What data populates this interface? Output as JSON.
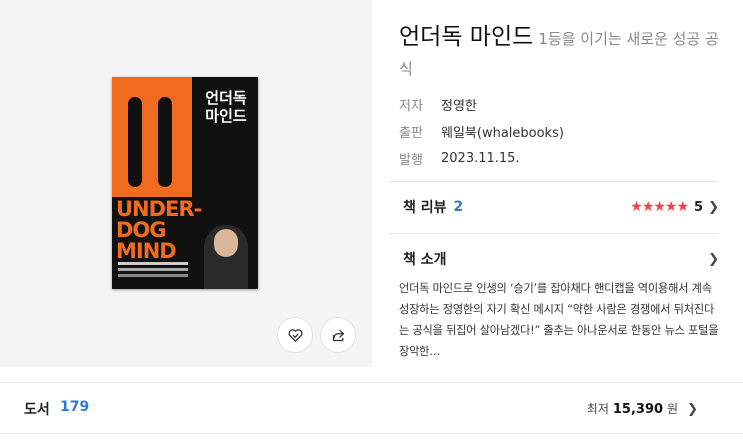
{
  "book": {
    "title": "언더독 마인드",
    "subtitle": "1등을 이기는 새로운 성공 공식",
    "cover_title": "언더독\n마인드",
    "cover_under": "UNDER-\nDOG\nMIND"
  },
  "meta": [
    {
      "key": "저자",
      "value": "정영한"
    },
    {
      "key": "출판",
      "value": "웨일북(whalebooks)"
    },
    {
      "key": "발행",
      "value": "2023.11.15."
    }
  ],
  "review": {
    "label": "책 리뷰",
    "count": "2",
    "stars": "★★★★★",
    "score": "5"
  },
  "intro": {
    "label": "책 소개",
    "text": "언더독 마인드로 인생의 ‘승기’를 잡아채다 핸디캡을 역이용해서 계속 성장하는 정영한의 자기 확신 메시지 “약한 사람은 경쟁에서 뒤처진다는 공식을 뒤집어 살아남겠다!” 출추는 아나운서로 한동안 뉴스 포털을 장악한…"
  },
  "store": {
    "label": "도서",
    "count": "179",
    "price_prefix": "최저",
    "price": "15,390",
    "price_unit": "원"
  },
  "colors": {
    "accent": "#2d7ad6",
    "star": "#f0424f",
    "cover_orange": "#f06a1f"
  },
  "icons": [
    "heart-check-icon",
    "share-icon",
    "chevron-right-icon"
  ]
}
